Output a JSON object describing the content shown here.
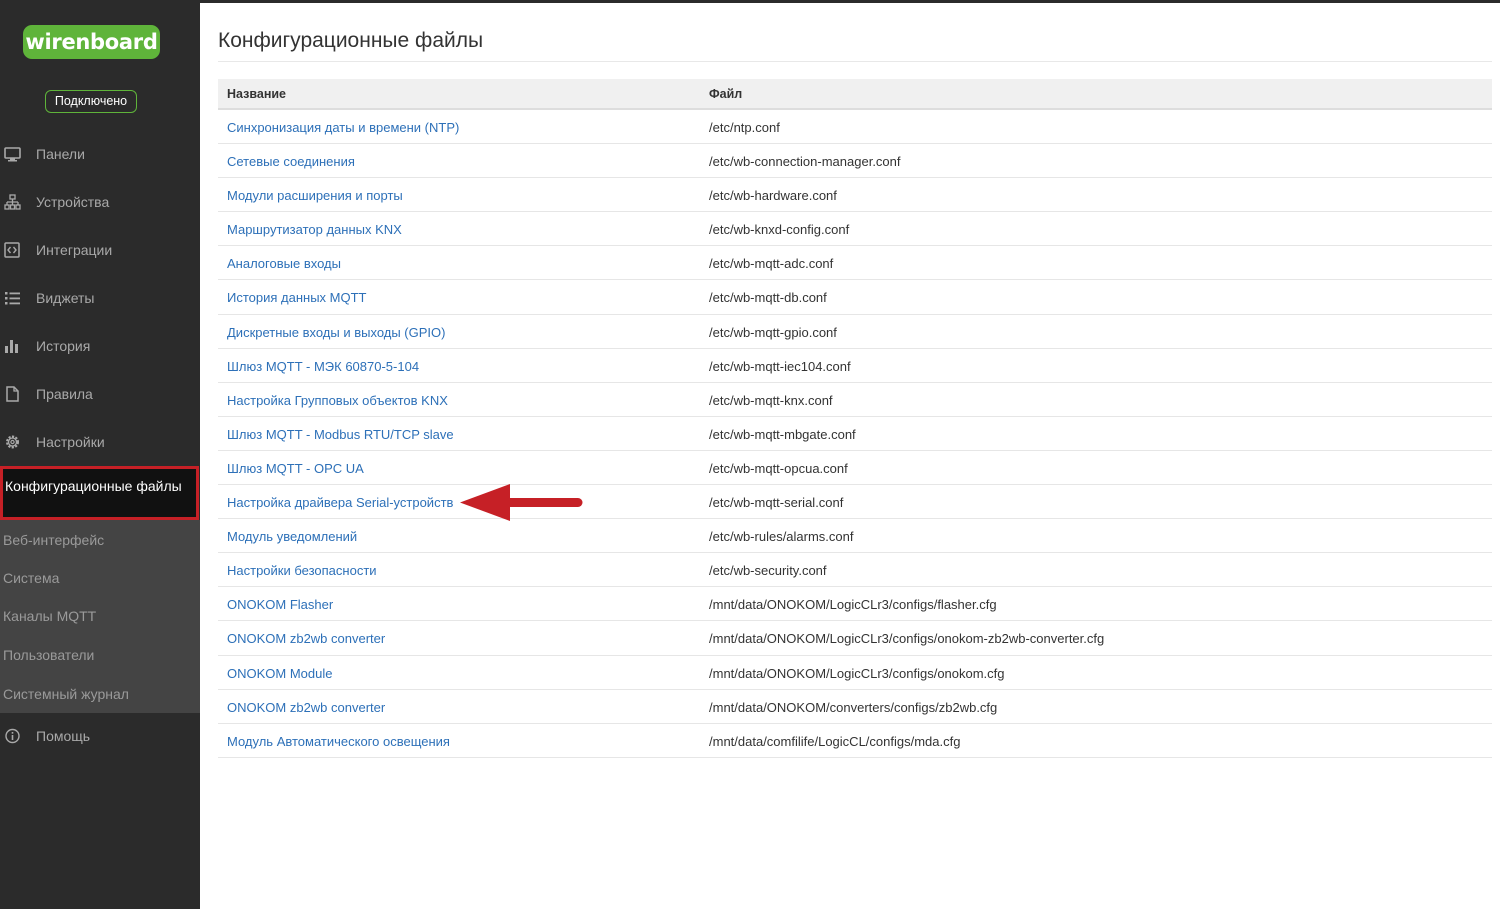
{
  "app": {
    "logo_text": "wirenboard",
    "connection_status": "Подключено",
    "brand_color": "#5fb43a",
    "highlight_color": "#c62026"
  },
  "sidebar": {
    "items": [
      {
        "label": "Панели",
        "icon": "monitor-icon"
      },
      {
        "label": "Устройства",
        "icon": "sitemap-icon"
      },
      {
        "label": "Интеграции",
        "icon": "code-icon"
      },
      {
        "label": "Виджеты",
        "icon": "list-icon"
      },
      {
        "label": "История",
        "icon": "bar-chart-icon"
      },
      {
        "label": "Правила",
        "icon": "file-icon"
      },
      {
        "label": "Настройки",
        "icon": "gear-icon"
      }
    ],
    "active_item": "Конфигурационные файлы",
    "sub_items": [
      "Веб-интерфейс",
      "Система",
      "Каналы MQTT",
      "Пользователи",
      "Системный журнал"
    ],
    "help": {
      "label": "Помощь",
      "icon": "info-icon"
    }
  },
  "main": {
    "title": "Конфигурационные файлы",
    "table": {
      "headers": [
        "Название",
        "Файл"
      ],
      "rows": [
        {
          "name": "Синхронизация даты и времени (NTP)",
          "file": "/etc/ntp.conf"
        },
        {
          "name": "Сетевые соединения",
          "file": "/etc/wb-connection-manager.conf"
        },
        {
          "name": "Модули расширения и порты",
          "file": "/etc/wb-hardware.conf"
        },
        {
          "name": "Маршрутизатор данных KNX",
          "file": "/etc/wb-knxd-config.conf"
        },
        {
          "name": "Аналоговые входы",
          "file": "/etc/wb-mqtt-adc.conf"
        },
        {
          "name": "История данных MQTT",
          "file": "/etc/wb-mqtt-db.conf"
        },
        {
          "name": "Дискретные входы и выходы (GPIO)",
          "file": "/etc/wb-mqtt-gpio.conf"
        },
        {
          "name": "Шлюз MQTT - МЭК 60870-5-104",
          "file": "/etc/wb-mqtt-iec104.conf"
        },
        {
          "name": "Настройка Групповых объектов KNX",
          "file": "/etc/wb-mqtt-knx.conf"
        },
        {
          "name": "Шлюз MQTT - Modbus RTU/TCP slave",
          "file": "/etc/wb-mqtt-mbgate.conf"
        },
        {
          "name": "Шлюз MQTT - OPC UA",
          "file": "/etc/wb-mqtt-opcua.conf"
        },
        {
          "name": "Настройка драйвера Serial-устройств",
          "file": "/etc/wb-mqtt-serial.conf"
        },
        {
          "name": "Модуль уведомлений",
          "file": "/etc/wb-rules/alarms.conf"
        },
        {
          "name": "Настройки безопасности",
          "file": "/etc/wb-security.conf"
        },
        {
          "name": "ONOKOM Flasher",
          "file": "/mnt/data/ONOKOM/LogicCLr3/configs/flasher.cfg"
        },
        {
          "name": "ONOKOM zb2wb converter",
          "file": "/mnt/data/ONOKOM/LogicCLr3/configs/onokom-zb2wb-converter.cfg"
        },
        {
          "name": "ONOKOM Module",
          "file": "/mnt/data/ONOKOM/LogicCLr3/configs/onokom.cfg"
        },
        {
          "name": "ONOKOM zb2wb converter",
          "file": "/mnt/data/ONOKOM/converters/configs/zb2wb.cfg"
        },
        {
          "name": "Модуль Автоматического освещения",
          "file": "/mnt/data/comfilife/LogicCL/configs/mda.cfg"
        }
      ]
    }
  }
}
